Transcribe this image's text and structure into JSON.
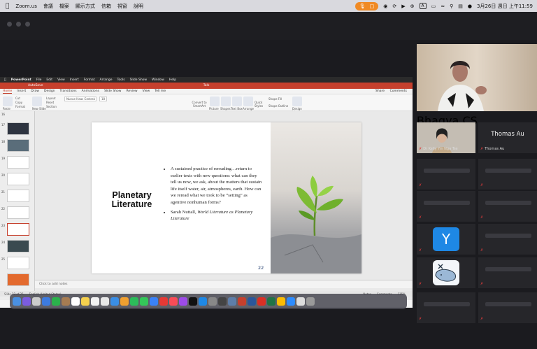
{
  "mac_menubar": {
    "menu_items": [
      "Zoom.us",
      "會議",
      "檔案",
      "顯示方式",
      "信箱",
      "視窗",
      "說明"
    ],
    "datetime": "3月26日 週日 上午11:59",
    "indicator_letter": "A"
  },
  "powerpoint": {
    "menu_items": [
      "PowerPoint",
      "File",
      "Edit",
      "View",
      "Insert",
      "Format",
      "Arrange",
      "Tools",
      "Slide Show",
      "Window",
      "Help"
    ],
    "doc_title": "Talk",
    "autosave_label": "AutoSave",
    "tabs": [
      "Home",
      "Insert",
      "Draw",
      "Design",
      "Transitions",
      "Animations",
      "Slide Show",
      "Review",
      "View",
      "Tell me"
    ],
    "share_label": "Share",
    "comments_label": "Comments",
    "ribbon": {
      "paste": "Paste",
      "cut": "Cut",
      "copy": "Copy",
      "format": "Format",
      "new_slide": "New Slide",
      "layout": "Layout",
      "reset": "Reset",
      "section": "Section",
      "font_name": "Nueue Haas Grotesk Text...",
      "font_size": "18",
      "convert_smartart": "Convert to SmartArt",
      "picture": "Picture",
      "shapes": "Shapes",
      "text_box": "Text Box",
      "arrange": "Arrange",
      "quick_styles": "Quick Styles",
      "shape_fill": "Shape Fill",
      "shape_outline": "Shape Outline",
      "design_ideas": "Design Ideas"
    },
    "thumb_numbers": [
      "16",
      "17",
      "18",
      "19",
      "20",
      "21",
      "22",
      "23",
      "24",
      "25"
    ],
    "slide": {
      "title_line1": "Planetary",
      "title_line2": "Literature",
      "bullet1": "A sustained practice of rereading…return to earlier texts with new questions: what can they tell us now, we ask, about the matters that sustain life itself water, air, atmospheres, earth. How can we reread what we took to be “setting” as agentive nonhuman forms?",
      "bullet2_author": "Sarah Nuttall, ",
      "bullet2_title": "World Literature as Planetary Literature",
      "number": "22"
    },
    "notes_placeholder": "Click to add notes",
    "status_slide": "Slide 22 of 25",
    "status_lang": "English (United States)",
    "status_notes": "Notes",
    "status_comments": "Comments",
    "zoom_level": "115%"
  },
  "zoom_panel": {
    "participants": [
      {
        "name": "Bhagya CS"
      },
      {
        "name": "Dr Kelly Yin Nga Tse"
      },
      {
        "name": "Thomas Au",
        "display": "Thomas Au"
      }
    ],
    "avatar_letter": "Y"
  },
  "colors": {
    "ppt_red": "#c6402d",
    "rec_orange": "#f08a24",
    "mute_red": "#e03b3b"
  }
}
